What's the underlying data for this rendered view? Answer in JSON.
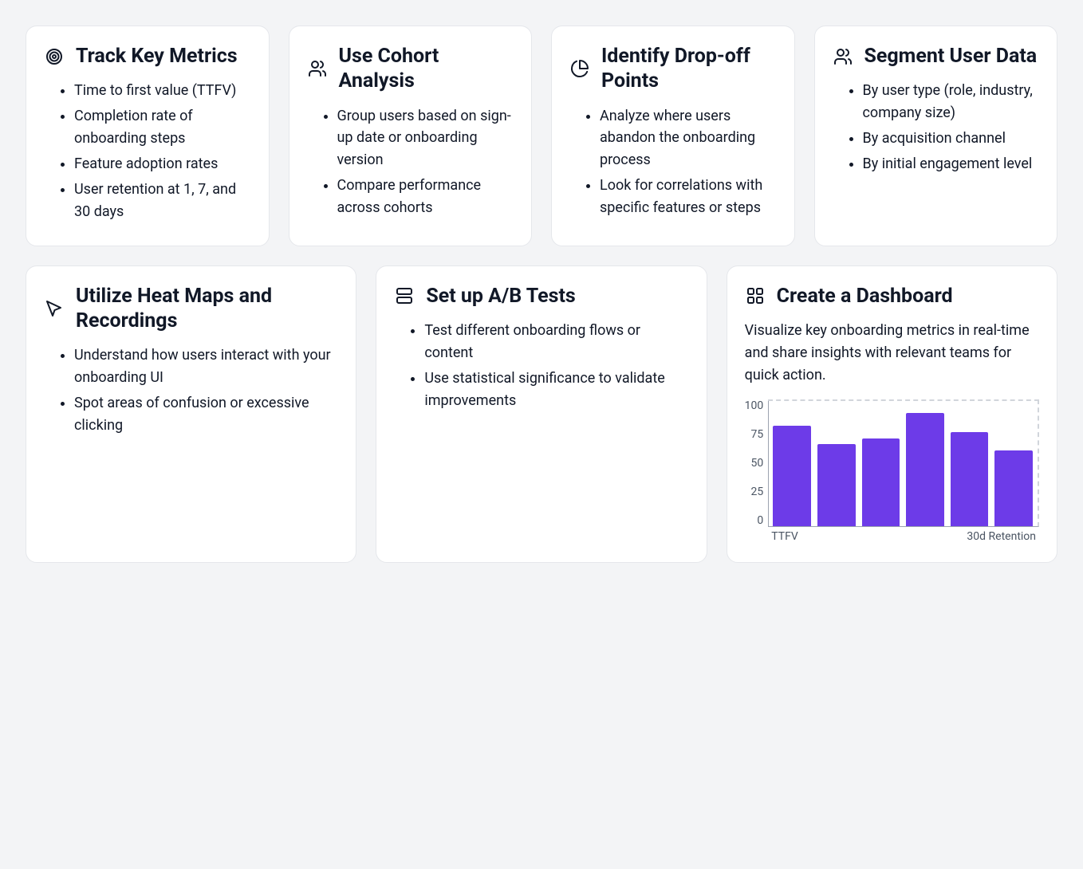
{
  "cards": {
    "track": {
      "title": "Track Key Metrics",
      "items": [
        "Time to first value (TTFV)",
        "Completion rate of onboarding steps",
        "Feature adoption rates",
        "User retention at 1, 7, and 30 days"
      ]
    },
    "cohort": {
      "title": "Use Cohort Analysis",
      "items": [
        "Group users based on sign-up date or onboarding version",
        "Compare performance across cohorts"
      ]
    },
    "dropoff": {
      "title": "Identify Drop-off Points",
      "items": [
        "Analyze where users abandon the onboarding process",
        "Look for correlations with specific features or steps"
      ]
    },
    "segment": {
      "title": "Segment User Data",
      "items": [
        "By user type (role, industry, company size)",
        "By acquisition channel",
        "By initial engagement level"
      ]
    },
    "heatmaps": {
      "title": "Utilize Heat Maps and Recordings",
      "items": [
        "Understand how users interact with your onboarding UI",
        "Spot areas of confusion or excessive clicking"
      ]
    },
    "abtests": {
      "title": "Set up A/B Tests",
      "items": [
        "Test different onboarding flows or content",
        "Use statistical significance to validate improvements"
      ]
    },
    "dashboard": {
      "title": "Create a Dashboard",
      "desc": "Visualize key onboarding metrics in real-time and share insights with relevant teams for quick action."
    }
  },
  "chart_data": {
    "type": "bar",
    "categories": [
      "TTFV",
      "",
      "",
      "30d Retention",
      "",
      ""
    ],
    "values": [
      80,
      65,
      70,
      90,
      75,
      60
    ],
    "y_ticks": [
      100,
      75,
      50,
      25,
      0
    ],
    "color": "#6d3be8",
    "ylim": [
      0,
      100
    ],
    "xaxis_labels_visible": [
      "TTFV",
      "30d Retention"
    ]
  }
}
